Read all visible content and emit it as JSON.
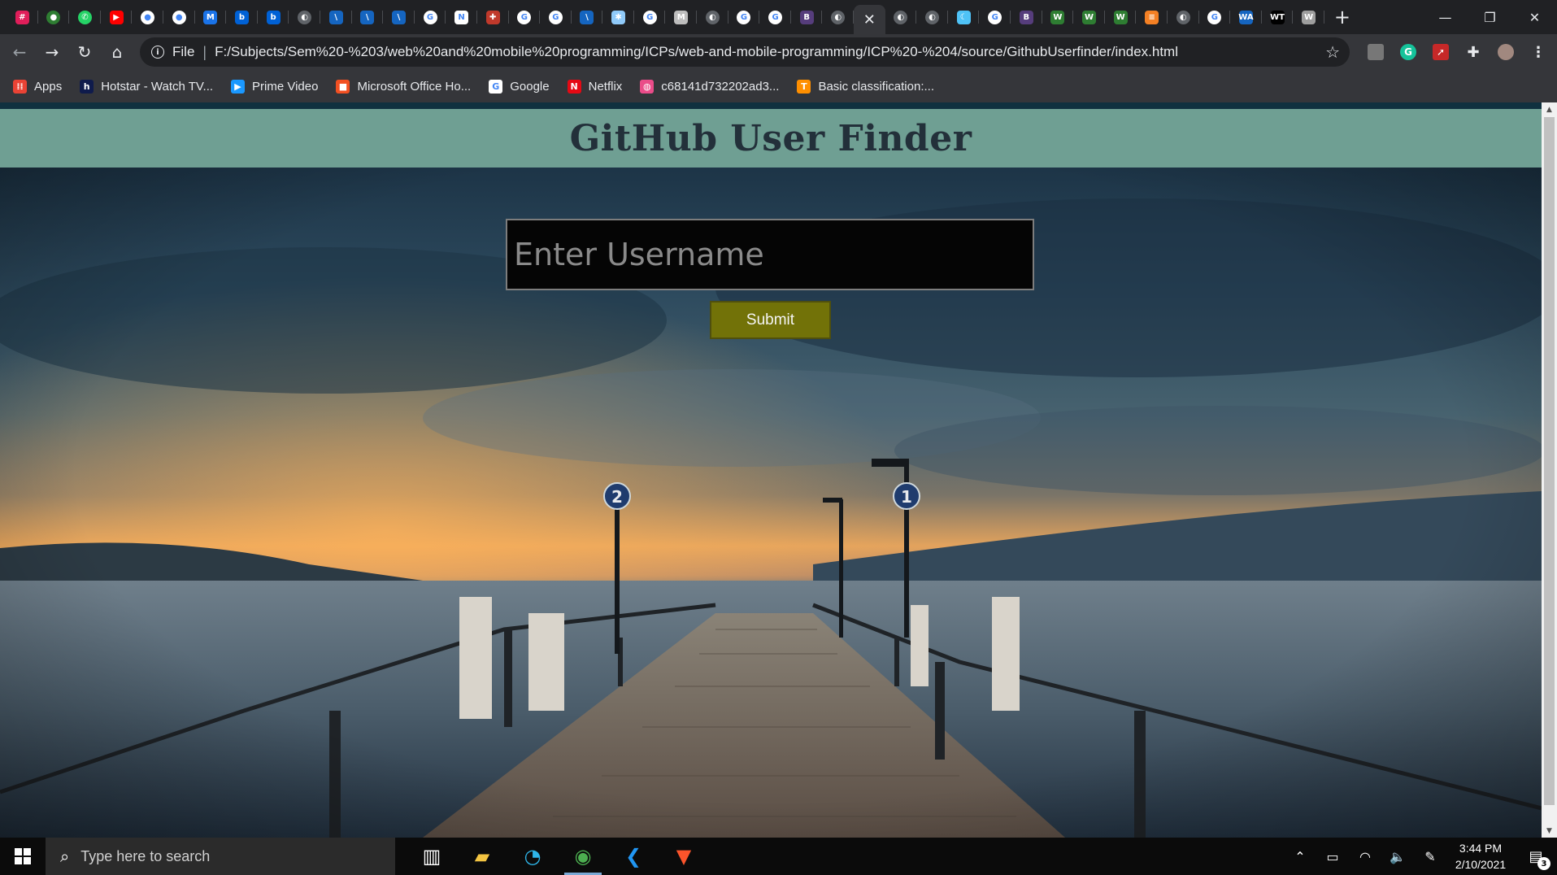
{
  "browser": {
    "tabs": [
      {
        "icon": "slack-icon",
        "color": "#e01e5a",
        "glyph": "#"
      },
      {
        "icon": "green-icon",
        "color": "#2e7d32",
        "glyph": "●"
      },
      {
        "icon": "whatsapp-icon",
        "color": "#25d366",
        "glyph": "✆"
      },
      {
        "icon": "youtube-icon",
        "color": "#ff0000",
        "glyph": "▶"
      },
      {
        "icon": "github-icon",
        "color": "#ffffff",
        "glyph": "●"
      },
      {
        "icon": "github-icon",
        "color": "#ffffff",
        "glyph": "●"
      },
      {
        "icon": "doc-icon",
        "color": "#1a73e8",
        "glyph": "M"
      },
      {
        "icon": "box-icon",
        "color": "#0061d5",
        "glyph": "b"
      },
      {
        "icon": "box-icon",
        "color": "#0061d5",
        "glyph": "b"
      },
      {
        "icon": "globe-icon",
        "color": "#5f6368",
        "glyph": "◐"
      },
      {
        "icon": "ms-icon",
        "color": "#1565c0",
        "glyph": "\\"
      },
      {
        "icon": "ms-icon",
        "color": "#1565c0",
        "glyph": "\\"
      },
      {
        "icon": "ms-icon",
        "color": "#1565c0",
        "glyph": "\\"
      },
      {
        "icon": "google-icon",
        "color": "#ffffff",
        "glyph": "G"
      },
      {
        "icon": "notion-icon",
        "color": "#ffffff",
        "glyph": "N"
      },
      {
        "icon": "shield-icon",
        "color": "#c0392b",
        "glyph": "✚"
      },
      {
        "icon": "google-icon",
        "color": "#ffffff",
        "glyph": "G"
      },
      {
        "icon": "google-icon",
        "color": "#ffffff",
        "glyph": "G"
      },
      {
        "icon": "ms-icon",
        "color": "#1565c0",
        "glyph": "\\"
      },
      {
        "icon": "snowflake-icon",
        "color": "#90caf9",
        "glyph": "✱"
      },
      {
        "icon": "google-icon",
        "color": "#ffffff",
        "glyph": "G"
      },
      {
        "icon": "doc-icon",
        "color": "#bdbdbd",
        "glyph": "M"
      },
      {
        "icon": "globe-icon",
        "color": "#5f6368",
        "glyph": "◐"
      },
      {
        "icon": "google-icon",
        "color": "#ffffff",
        "glyph": "G"
      },
      {
        "icon": "google-icon",
        "color": "#ffffff",
        "glyph": "G"
      },
      {
        "icon": "bootstrap-icon",
        "color": "#563d7c",
        "glyph": "B"
      },
      {
        "icon": "globe-icon",
        "color": "#5f6368",
        "glyph": "◐"
      },
      {
        "icon": "close-icon",
        "color": "#35363a",
        "glyph": "✕",
        "active": true
      },
      {
        "icon": "globe-icon",
        "color": "#5f6368",
        "glyph": "◐"
      },
      {
        "icon": "globe-icon",
        "color": "#5f6368",
        "glyph": "◐"
      },
      {
        "icon": "moon-icon",
        "color": "#4fc3f7",
        "glyph": "☾"
      },
      {
        "icon": "google-icon",
        "color": "#ffffff",
        "glyph": "G"
      },
      {
        "icon": "bootstrap-icon",
        "color": "#563d7c",
        "glyph": "B"
      },
      {
        "icon": "w-icon",
        "color": "#2e7d32",
        "glyph": "W"
      },
      {
        "icon": "w-icon",
        "color": "#2e7d32",
        "glyph": "W"
      },
      {
        "icon": "w-icon",
        "color": "#2e7d32",
        "glyph": "W"
      },
      {
        "icon": "stack-icon",
        "color": "#f48024",
        "glyph": "≡"
      },
      {
        "icon": "globe-icon",
        "color": "#5f6368",
        "glyph": "◐"
      },
      {
        "icon": "google-icon",
        "color": "#ffffff",
        "glyph": "G"
      },
      {
        "icon": "wa-icon",
        "color": "#1565c0",
        "glyph": "WA"
      },
      {
        "icon": "wt-icon",
        "color": "#000000",
        "glyph": "WT"
      },
      {
        "icon": "w-icon",
        "color": "#9e9e9e",
        "glyph": "W"
      }
    ],
    "new_tab": "+",
    "window": {
      "minimize": "—",
      "restore": "❐",
      "close": "✕"
    },
    "address": {
      "scheme": "File",
      "url": "F:/Subjects/Sem%20-%203/web%20and%20mobile%20programming/ICPs/web-and-mobile-programming/ICP%20-%204/source/GithubUserfinder/index.html"
    },
    "bookmarks": [
      {
        "label": "Apps",
        "icon": "apps-grid-icon",
        "color": "#ea4335",
        "glyph": "⁞⁞"
      },
      {
        "label": "Hotstar - Watch TV...",
        "icon": "hotstar-icon",
        "color": "#0f1b4c",
        "glyph": "h"
      },
      {
        "label": "Prime Video",
        "icon": "prime-video-icon",
        "color": "#1a98ff",
        "glyph": "▶"
      },
      {
        "label": "Microsoft Office Ho...",
        "icon": "office-icon",
        "color": "#f25022",
        "glyph": "■"
      },
      {
        "label": "Google",
        "icon": "google-icon",
        "color": "#ffffff",
        "glyph": "G"
      },
      {
        "label": "Netflix",
        "icon": "netflix-icon",
        "color": "#e50914",
        "glyph": "N"
      },
      {
        "label": "c68141d732202ad3...",
        "icon": "dribbble-icon",
        "color": "#ea4c89",
        "glyph": "◍"
      },
      {
        "label": "Basic classification:...",
        "icon": "tensorflow-icon",
        "color": "#ff8f00",
        "glyph": "T"
      }
    ]
  },
  "page": {
    "title": "GitHub User Finder",
    "input_placeholder": "Enter Username",
    "submit_label": "Submit",
    "colors": {
      "header": "#6f9f93",
      "button": "#727208",
      "input": "#050505"
    }
  },
  "taskbar": {
    "search_placeholder": "Type here to search",
    "apps": [
      {
        "icon": "task-view-icon"
      },
      {
        "icon": "file-explorer-icon"
      },
      {
        "icon": "edge-icon"
      },
      {
        "icon": "chrome-icon",
        "running": true
      },
      {
        "icon": "vscode-icon"
      },
      {
        "icon": "brave-icon"
      }
    ],
    "time": "3:44 PM",
    "date": "2/10/2021",
    "notification_count": "3"
  }
}
